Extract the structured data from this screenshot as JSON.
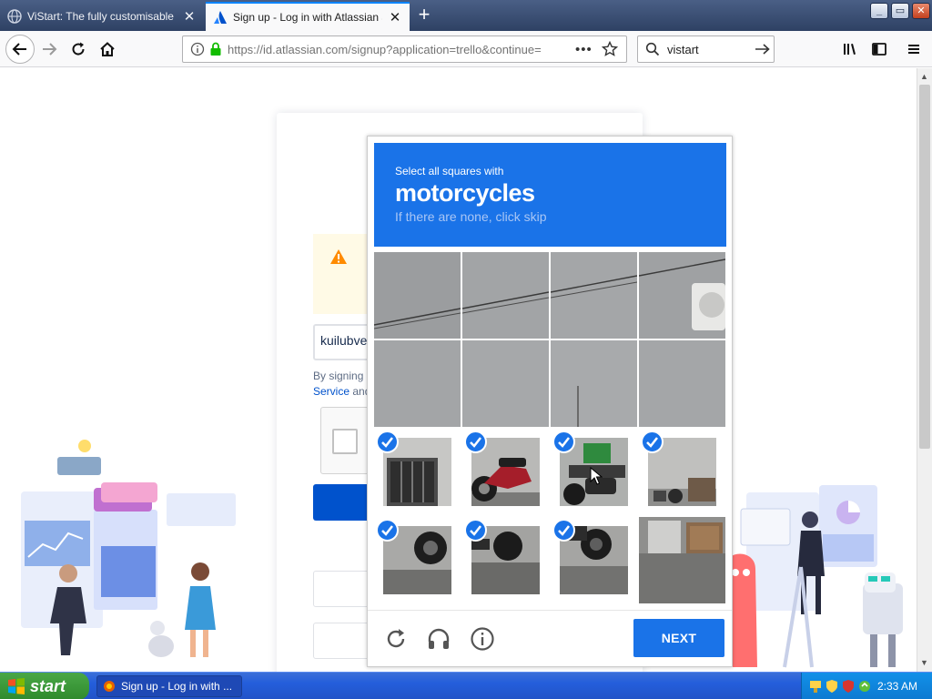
{
  "browser": {
    "tabs": [
      {
        "title": "ViStart: The fully customisable start",
        "active": false
      },
      {
        "title": "Sign up - Log in with Atlassian account",
        "active": true
      }
    ],
    "new_tab_label": "+",
    "url": "https://id.atlassian.com/signup?application=trello&continue=",
    "search_value": "vistart"
  },
  "signup": {
    "email_value": "kuilubve",
    "legal_prefix": "By signing",
    "legal_link": "Service",
    "legal_suffix": "and"
  },
  "captcha": {
    "instruction": "Select all squares with",
    "target": "motorcycles",
    "hint": "If there are none, click skip",
    "next_label": "NEXT",
    "tiles": [
      {
        "selected": false
      },
      {
        "selected": false
      },
      {
        "selected": false
      },
      {
        "selected": false
      },
      {
        "selected": false
      },
      {
        "selected": false
      },
      {
        "selected": false
      },
      {
        "selected": false
      },
      {
        "selected": true
      },
      {
        "selected": true
      },
      {
        "selected": true
      },
      {
        "selected": true
      },
      {
        "selected": true
      },
      {
        "selected": true
      },
      {
        "selected": true
      },
      {
        "selected": false
      }
    ],
    "accent_color": "#1a73e8"
  },
  "taskbar": {
    "start_label": "start",
    "task_label": "Sign up - Log in with ...",
    "clock": "2:33 AM"
  }
}
